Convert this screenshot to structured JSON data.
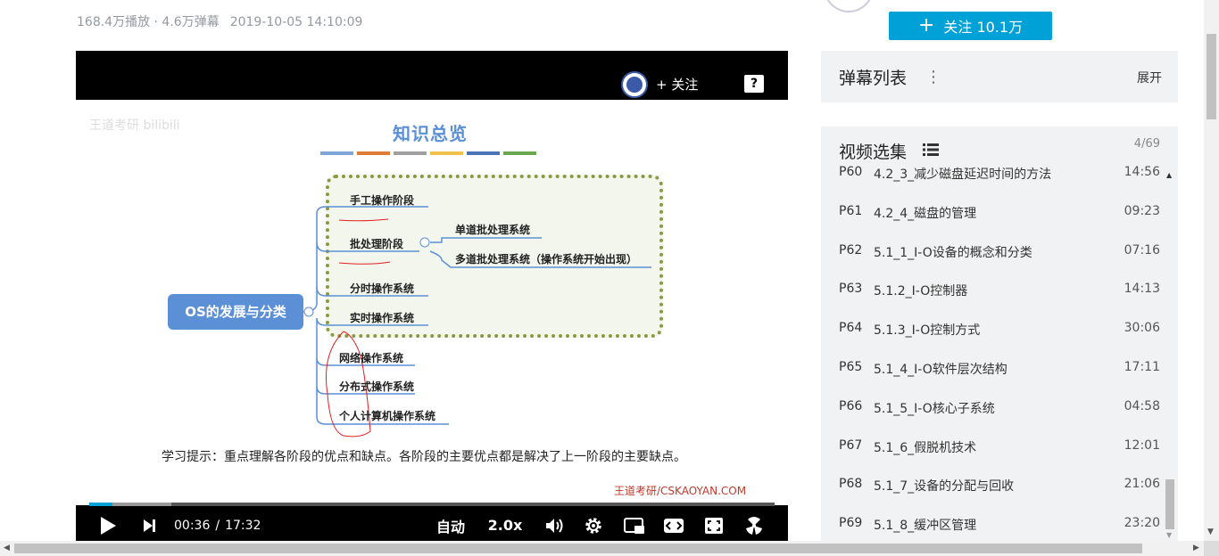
{
  "video_meta": {
    "plays": "168.4万播放 · 4.6万弹幕",
    "date": "2019-10-05 14:10:09"
  },
  "uploader": {
    "follow_label": "关注 10.1万",
    "follow_plus": "+"
  },
  "player": {
    "follow_mini": "+ 关注",
    "help_label": "?",
    "slide": {
      "watermark": "王道考研 bilibili",
      "title": "知识总览",
      "title_bar_colors": [
        "#7ea6d9",
        "#e07b39",
        "#a0a0a0",
        "#f2c04d",
        "#4a73b8",
        "#6aa84f"
      ],
      "root": "OS的发展与分类",
      "nodes": {
        "manual": "手工操作阶段",
        "batch": "批处理阶段",
        "single_batch": "单道批处理系统",
        "multi_batch": "多道批处理系统（操作系统开始出现）",
        "timesharing": "分时操作系统",
        "realtime": "实时操作系统",
        "network": "网络操作系统",
        "distributed": "分布式操作系统",
        "personal": "个人计算机操作系统"
      },
      "tip": "学习提示：重点理解各阶段的优点和缺点。各阶段的主要优点都是解决了上一阶段的主要缺点。",
      "brand": "王道考研/CSKAOYAN.COM"
    },
    "progress": 0.034,
    "buffered": 0.12,
    "controls": {
      "current_time": "00:36",
      "separator": "/",
      "total_time": "17:32",
      "quality": "自动",
      "speed": "2.0x"
    }
  },
  "danmaku": {
    "title": "弹幕列表",
    "more": "⋮",
    "expand": "展开"
  },
  "episodes": {
    "title": "视频选集",
    "count": "4/69",
    "items": [
      {
        "code": "P60",
        "name": "4.2_3_减少磁盘延迟时间的方法",
        "dur": "14:56"
      },
      {
        "code": "P61",
        "name": "4.2_4_磁盘的管理",
        "dur": "09:23"
      },
      {
        "code": "P62",
        "name": "5.1_1_I-O设备的概念和分类",
        "dur": "07:16"
      },
      {
        "code": "P63",
        "name": "5.1.2_I-O控制器",
        "dur": "14:13"
      },
      {
        "code": "P64",
        "name": "5.1.3_I-O控制方式",
        "dur": "30:06"
      },
      {
        "code": "P65",
        "name": "5.1_4_I-O软件层次结构",
        "dur": "17:11"
      },
      {
        "code": "P66",
        "name": "5.1_5_I-O核心子系统",
        "dur": "04:58"
      },
      {
        "code": "P67",
        "name": "5.1_6_假脱机技术",
        "dur": "12:01"
      },
      {
        "code": "P68",
        "name": "5.1_7_设备的分配与回收",
        "dur": "21:06"
      },
      {
        "code": "P69",
        "name": "5.1_8_缓冲区管理",
        "dur": "23:20"
      }
    ]
  }
}
